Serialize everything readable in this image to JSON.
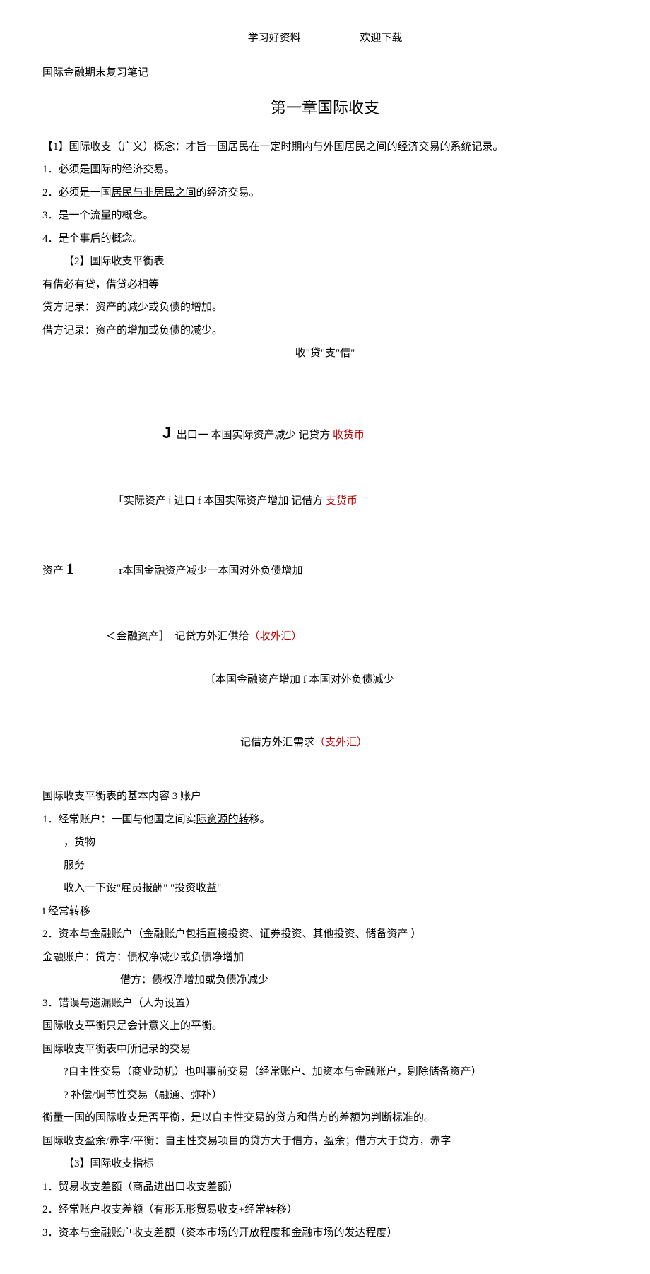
{
  "header": {
    "left": "学习好资料",
    "right": "欢迎下载"
  },
  "doc_title": "国际金融期末复习笔记",
  "chapter_title": "第一章国际收支",
  "sec1": {
    "label": "【1】",
    "title_link": "国际收支（广义）概念：才",
    "title_rest": "旨一国居民在一定时期内与外国居民之间的经济交易的系统记录。",
    "items": [
      {
        "num": "1",
        "text": "．必须是国际的经济交易。"
      },
      {
        "num": "2",
        "text_before": "．必须是一国",
        "link": "居民与非居民之间",
        "text_after": "的经济交易。"
      },
      {
        "num": "3",
        "text": "．是一个流量的概念。"
      },
      {
        "num": "4",
        "text": "．是个事后的概念。"
      }
    ]
  },
  "sec2": {
    "label": "【2】国际收支平衡表",
    "lines": [
      "有借必有贷，借贷必相等",
      "贷方记录：资产的减少或负债的增加。",
      "借方记录：资产的增加或负债的减少。"
    ],
    "center": "收\"贷\"支\"借\""
  },
  "diagram": {
    "l1_j": "J",
    "l1": "出口一 本国实际资产减少 记贷方",
    "l1_red": "收货币",
    "l2_pre": "「实际资产",
    "l2_i": "i",
    "l2": "进口 f 本国实际资产增加 记借方",
    "l2_red": "支货币",
    "l3_pre": "资产",
    "l3_one": "1",
    "l3": "r本国金融资产减少一本国对外负债增加",
    "l4_pre": "＜金融资产］",
    "l4": "记贷方外汇供给",
    "l4_red": "（收外汇）",
    "l5": "〔本国金融资产增加 f 本国对外负债减少",
    "l6": "记借方外汇需求",
    "l6_red": "（支外汇）"
  },
  "sec2b": {
    "title": "国际收支平衡表的基本内容 3 账户",
    "acct1": {
      "num": "1",
      "before": "．经常账户：一国与他国之间实",
      "link": "际资源的转",
      "after": "移。"
    },
    "sub": [
      "，货物",
      "服务",
      "收入一下设\"雇员报酬\"    \"投资收益\""
    ],
    "sub_transfer": "i 经常转移",
    "acct2": {
      "num": "2",
      "text": "．资本与金融账户（金融账户包括直接投资、证券投资、其他投资、储备资产     ）"
    },
    "fin_lines": [
      "金融账户：贷方：债权净减少或负债净增加",
      "借方：债权净增加或负债净减少"
    ],
    "acct3": {
      "num": "3",
      "text": "．错误与遗漏账户（人为设置）"
    },
    "more": [
      "国际收支平衡只是会计意义上的平衡。",
      "国际收支平衡表中所记录的交易"
    ],
    "q1": "?自主性交易（商业动机）也叫事前交易（经常账户、加资本与金融账户，剔除储备资产）",
    "q2": "? 补偿/调节性交易（融通、弥补）",
    "balance": "衡量一国的国际收支是否平衡，是以自主性交易的贷方和借方的差额为判断标准的。",
    "surplus": {
      "before": "国际收支盈余/赤字/平衡：",
      "link": "自主性交易项目的贷",
      "after": "方大于借方，盈余；借方大于贷方，赤字"
    }
  },
  "sec3": {
    "label": "【3】国际收支指标",
    "items": [
      {
        "num": "1",
        "text": "．贸易收支差额（商品进出口收支差额）"
      },
      {
        "num": "2",
        "text": "．经常账户收支差额（有形无形贸易收支+经常转移）"
      },
      {
        "num": "3",
        "text": "．资本与金融账户收支差额（资本市场的开放程度和金融市场的发达程度）"
      }
    ]
  }
}
